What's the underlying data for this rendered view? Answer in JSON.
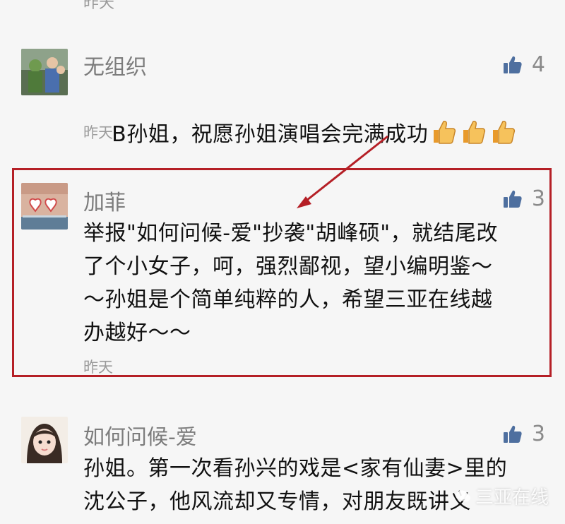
{
  "top_time": "昨天",
  "comments": [
    {
      "name": "无组织",
      "likes": "4",
      "text": "B孙姐，祝愿孙姐演唱会完满成功",
      "emoji_count": 3,
      "time": "昨天"
    },
    {
      "name": "加菲",
      "likes": "3",
      "text": "举报\"如何问候-爱\"抄袭\"胡峰硕\"，就结尾改\n了个小女子，呵，强烈鄙视，望小编明鉴～\n～孙姐是个简单纯粹的人，希望三亚在线越\n办越好～～",
      "time": "昨天"
    },
    {
      "name": "如何问候-爱",
      "likes": "3",
      "text": "孙姐。第一次看孙兴的戏是<家有仙妻>里的\n沈公子，他风流却又专情，对朋友既讲义"
    }
  ],
  "watermark": "三亚在线",
  "colors": {
    "highlight": "#b51f26",
    "like_icon": "#4e6f9f",
    "text": "#111111",
    "meta": "#9a9a9a"
  }
}
